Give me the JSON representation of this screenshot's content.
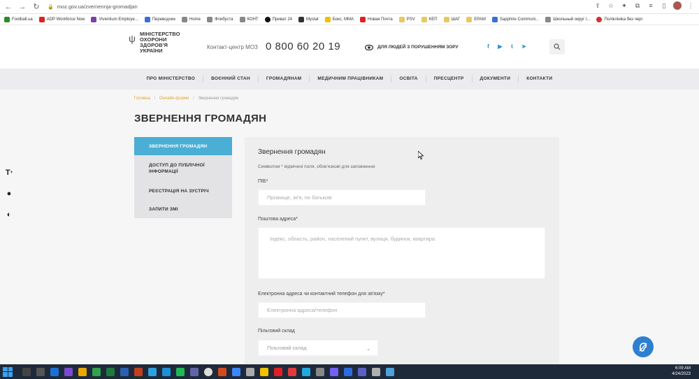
{
  "browser": {
    "url": "moz.gov.ua/zvernennja-gromadjan",
    "bookmarks": [
      "Football.ua",
      "ADP Workforce Now",
      "Viventium Employe...",
      "Переводчик",
      "Home",
      "Флибуста",
      "КОНТ",
      "Приват 24",
      "Mystat",
      "Бокс, MMA",
      "Новая Почта",
      "PSV",
      "КЕП",
      "ШАГ",
      "EPAM",
      "Sapphire Communi...",
      "Школьный округ г...",
      "Поліклініка без черг"
    ]
  },
  "header": {
    "logo_text": "МІНІСТЕРСТВО ОХОРОНИ ЗДОРОВ'Я УКРАЇНИ",
    "contact_label": "Контакт-центр МОЗ",
    "phone": "0 800 60 20 19",
    "vision_link": "ДЛЯ ЛЮДЕЙ З ПОРУШЕННЯМ ЗОРУ",
    "socials": [
      "f",
      "▶",
      "t",
      "➤"
    ]
  },
  "nav": {
    "items": [
      "ПРО МІНІСТЕРСТВО",
      "ВОЄННИЙ СТАН",
      "ГРОМАДЯНАМ",
      "МЕДИЧНИМ ПРАЦІВНИКАМ",
      "ОСВІТА",
      "ПРЕСЦЕНТР",
      "ДОКУМЕНТИ",
      "КОНТАКТИ"
    ]
  },
  "breadcrumb": {
    "home": "Головна",
    "section": "Онлайн-форми",
    "current": "Звернення громадян"
  },
  "page": {
    "title": "ЗВЕРНЕННЯ ГРОМАДЯН"
  },
  "sidebar": {
    "items": [
      "ЗВЕРНЕННЯ ГРОМАДЯН",
      "ДОСТУП ДО ПУБЛІЧНОЇ ІНФОРМАЦІЇ",
      "РЕЄСТРАЦІЯ НА ЗУСТРІЧ",
      "ЗАПИТИ ЗМІ"
    ]
  },
  "form": {
    "title": "Звернення громадян",
    "note": "Символом * відмічені поля, обов'язкові для заповнення",
    "name_label": "ПІБ*",
    "name_placeholder": "Прізвище, ім'я, по батькові",
    "address_label": "Поштова адреса*",
    "address_placeholder": "Індекс, область, район, населений пункт, вулиця, будинок, квартира",
    "contact_label": "Електронна адреса чи контактний телефон для зв'язку*",
    "contact_placeholder": "Електронна адреса/телефон",
    "benefit_label": "Пільговий склад",
    "benefit_selected": "Пільговий склад"
  },
  "taskbar": {
    "time": "6:09 AM",
    "date": "4/24/2023"
  }
}
